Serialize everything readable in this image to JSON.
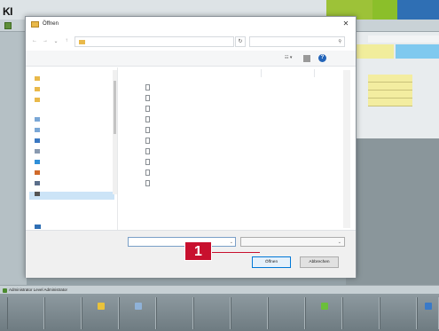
{
  "app": {
    "logo": "KI",
    "logo_sub": "",
    "status_light_text": "",
    "status_datetime": "",
    "side_panel_header": "",
    "side_tab_a": "",
    "side_tab_b": "",
    "side_rows": [
      "",
      "",
      "",
      ""
    ],
    "statusbar_text": "Administrator  Level Administrator",
    "softkey_label": ""
  },
  "dialog": {
    "title": "Öffnen",
    "close_glyph": "✕",
    "address_path": "",
    "search_placeholder": "",
    "cmd_organize": "",
    "cmd_new_folder": "",
    "help_glyph": "?",
    "columns": {
      "name": "",
      "date": "",
      "type": ""
    },
    "nav_items": [
      {
        "label": "",
        "selected": false,
        "color": "#e9b94a"
      },
      {
        "label": "",
        "selected": false,
        "color": "#e9b94a"
      },
      {
        "label": "",
        "selected": false,
        "color": "#e9b94a"
      },
      {
        "label": "",
        "selected": false,
        "color": "#7aa7d6"
      },
      {
        "label": "",
        "selected": false,
        "color": "#7aa7d6"
      },
      {
        "label": "",
        "selected": false,
        "color": "#3a78c2"
      },
      {
        "label": "",
        "selected": false,
        "color": "#8a9ab0"
      },
      {
        "label": "",
        "selected": false,
        "color": "#2f8fd8"
      },
      {
        "label": "",
        "selected": false,
        "color": "#d06a2a"
      },
      {
        "label": "",
        "selected": false,
        "color": "#5a6e8a"
      },
      {
        "label": "",
        "selected": true,
        "color": "#555555"
      }
    ],
    "network_label": "",
    "files": [
      {
        "name": "",
        "date": "",
        "type": ""
      },
      {
        "name": "",
        "date": "",
        "type": ""
      },
      {
        "name": "",
        "date": "",
        "type": ""
      },
      {
        "name": "",
        "date": "",
        "type": ""
      },
      {
        "name": "",
        "date": "",
        "type": ""
      },
      {
        "name": "",
        "date": "",
        "type": ""
      },
      {
        "name": "",
        "date": "",
        "type": ""
      },
      {
        "name": "",
        "date": "",
        "type": ""
      },
      {
        "name": "",
        "date": "",
        "type": ""
      },
      {
        "name": "",
        "date": "",
        "type": ""
      }
    ],
    "filename_label": "",
    "filename_value": "",
    "filter_value": "",
    "open_label": "Öffnen",
    "cancel_label": "Abbrechen"
  },
  "callout": {
    "number": "1"
  },
  "colors": {
    "callout_red": "#c8102e",
    "accent_blue": "#0078d7",
    "status_green": "#9dc238",
    "status_blue": "#2f6fb4"
  }
}
